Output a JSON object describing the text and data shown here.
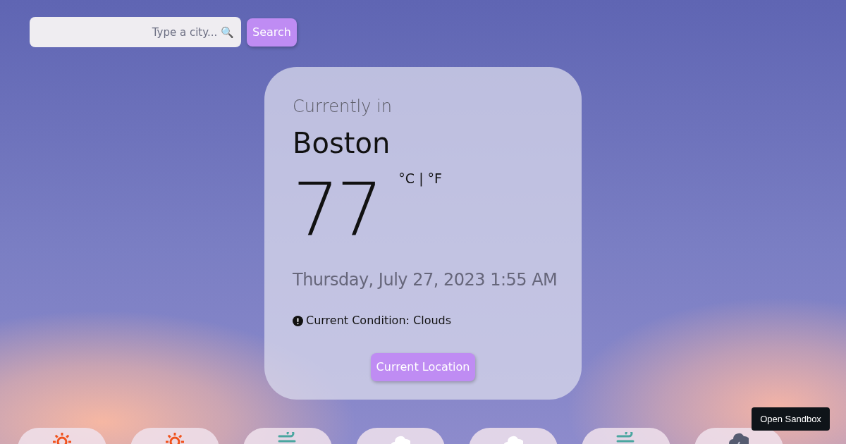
{
  "search": {
    "placeholder": "Type a city... 🔍",
    "button": "Search"
  },
  "current": {
    "heading": "Currently in",
    "city": "Boston",
    "temperature": "77",
    "units": "°C | °F",
    "date": "Thursday, July 27, 2023 1:55 AM",
    "condition": "Current Condition: Clouds",
    "location_button": "Current Location"
  },
  "forecast": [
    {
      "kind": "sun"
    },
    {
      "kind": "sun"
    },
    {
      "kind": "wind"
    },
    {
      "kind": "cloud"
    },
    {
      "kind": "cloud"
    },
    {
      "kind": "wind"
    },
    {
      "kind": "storm"
    }
  ],
  "sandbox_button": "Open Sandbox"
}
